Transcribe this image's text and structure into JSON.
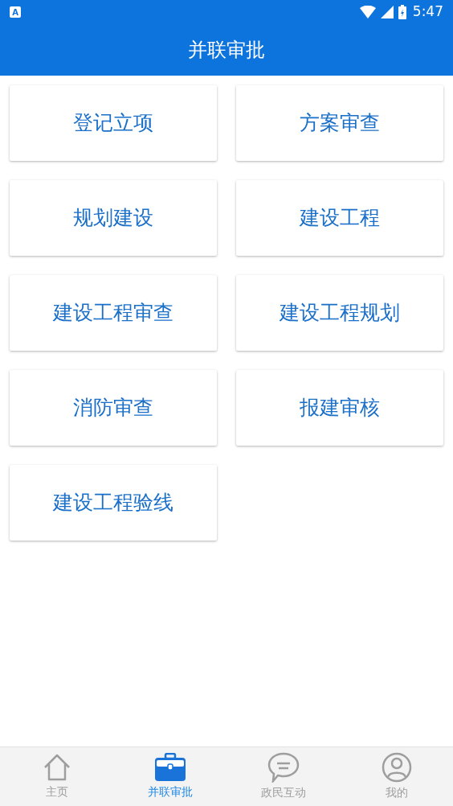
{
  "status_bar": {
    "time": "5:47",
    "notification": "A"
  },
  "header": {
    "title": "并联审批"
  },
  "tiles": [
    "登记立项",
    "方案审查",
    "规划建设",
    "建设工程",
    "建设工程审查",
    "建设工程规划",
    "消防审查",
    "报建审核",
    "建设工程验线"
  ],
  "tabs": [
    {
      "label": "主页",
      "kind": "home",
      "selected": false
    },
    {
      "label": "并联审批",
      "kind": "briefcase",
      "selected": true
    },
    {
      "label": "政民互动",
      "kind": "chat",
      "selected": false
    },
    {
      "label": "我的",
      "kind": "profile",
      "selected": false
    }
  ]
}
